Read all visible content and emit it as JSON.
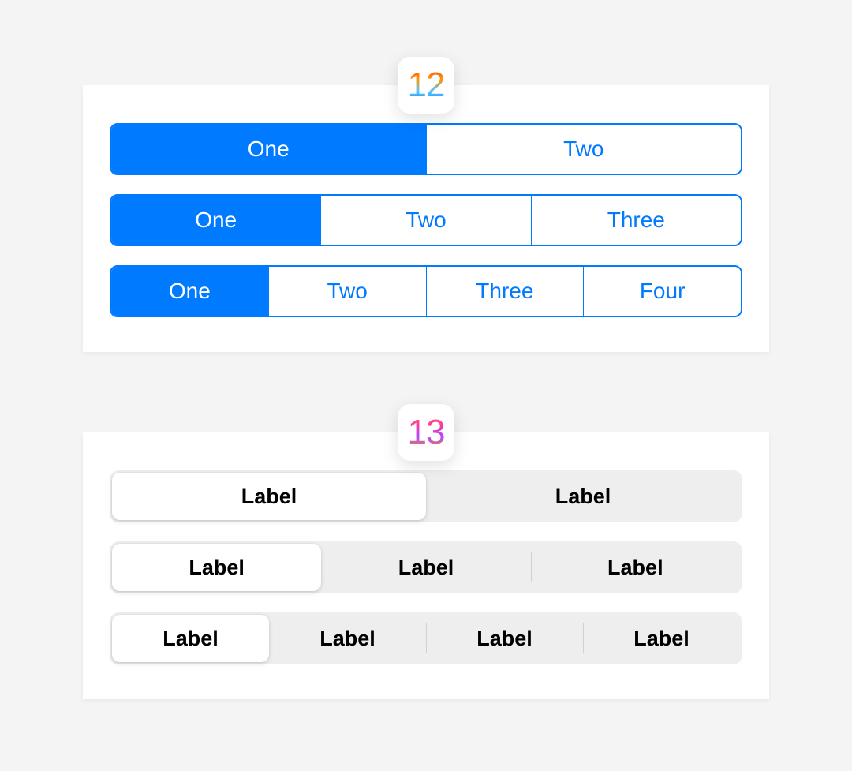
{
  "badges": {
    "twelve": "12",
    "thirteen": "13"
  },
  "ios12": {
    "rows": [
      {
        "items": [
          "One",
          "Two"
        ],
        "selected": 0
      },
      {
        "items": [
          "One",
          "Two",
          "Three"
        ],
        "selected": 0
      },
      {
        "items": [
          "One",
          "Two",
          "Three",
          "Four"
        ],
        "selected": 0
      }
    ]
  },
  "ios13": {
    "rows": [
      {
        "items": [
          "Label",
          "Label"
        ],
        "selected": 0
      },
      {
        "items": [
          "Label",
          "Label",
          "Label"
        ],
        "selected": 0
      },
      {
        "items": [
          "Label",
          "Label",
          "Label",
          "Label"
        ],
        "selected": 0
      }
    ]
  },
  "colors": {
    "ios12_accent": "#007aff",
    "ios13_track": "#eeeeef"
  }
}
